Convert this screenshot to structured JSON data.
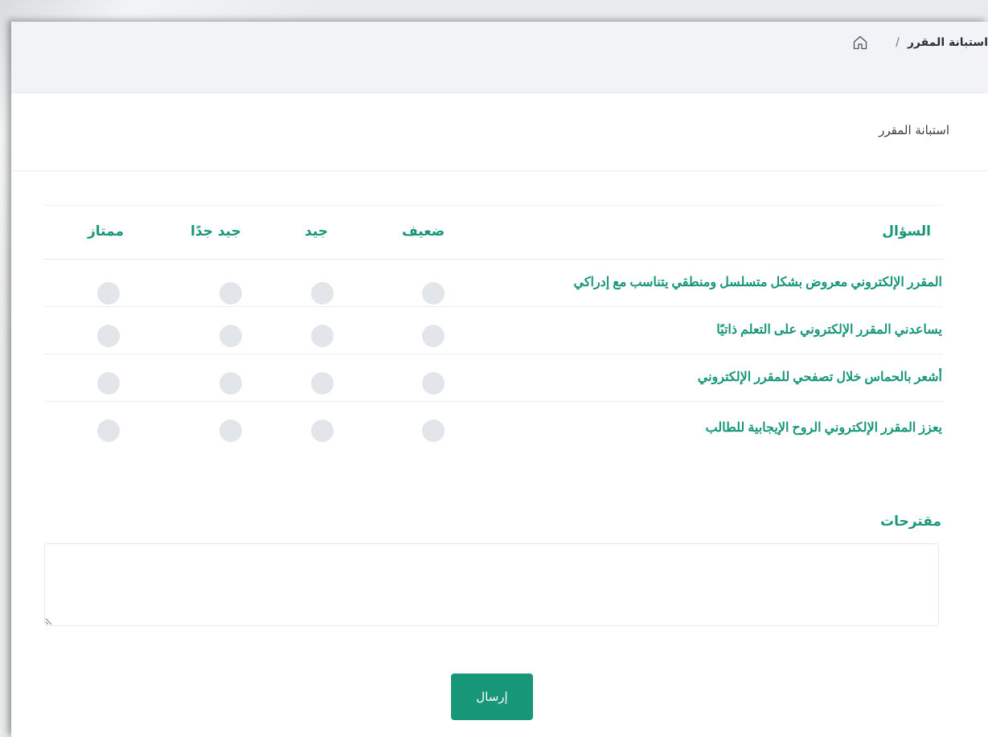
{
  "breadcrumb": {
    "home_icon": "home-icon",
    "separator": "/",
    "current": "استبانة المقرر"
  },
  "card": {
    "title": "استبانة المقرر"
  },
  "survey": {
    "headers": {
      "question": "السؤال",
      "poor": "ضعيف",
      "good": "جيد",
      "very_good": "جيد جدًا",
      "excellent": "ممتاز"
    },
    "questions": [
      "المقرر الإلكتروني معروض بشكل متسلسل ومنطقي يتناسب مع إدراكي",
      "يساعدني المقرر الإلكتروني على التعلم ذاتيًا",
      "أشعر بالحماس خلال تصفحي للمقرر الإلكتروني",
      "يعزز المقرر الإلكتروني الروح الإيجابية للطالب"
    ]
  },
  "suggestions": {
    "label": "مقترحات",
    "value": ""
  },
  "submit": {
    "label": "إرسال"
  },
  "colors": {
    "accent": "#179778",
    "radio": "#e2e5ea",
    "topbar": "#f1f3f6"
  }
}
